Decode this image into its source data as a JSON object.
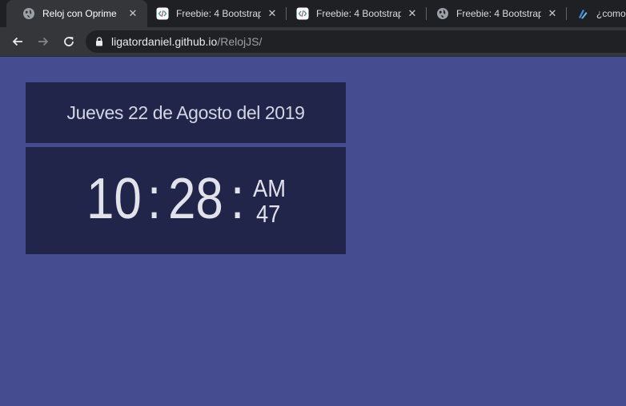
{
  "browser": {
    "tabs": [
      {
        "title": "Reloj con Oprime",
        "icon": "globe-icon",
        "active": true
      },
      {
        "title": "Freebie: 4 Bootstrap",
        "icon": "code-icon",
        "active": false
      },
      {
        "title": "Freebie: 4 Bootstrap",
        "icon": "code-icon",
        "active": false
      },
      {
        "title": "Freebie: 4 Bootstrap",
        "icon": "globe-icon",
        "active": false
      },
      {
        "title": "¿como",
        "icon": "stack-icon",
        "active": false
      }
    ],
    "close_glyph": "✕",
    "url": {
      "host": "ligatordaniel.github.io",
      "path": "/RelojJS/"
    }
  },
  "clock": {
    "date_text": "Jueves 22 de Agosto del 2019",
    "hours": "10",
    "separator": ":",
    "minutes": "28",
    "ampm": "AM",
    "seconds": "47"
  },
  "colors": {
    "page_background": "#454c90",
    "panel_background": "#22254a",
    "text": "#e2e2ea"
  }
}
